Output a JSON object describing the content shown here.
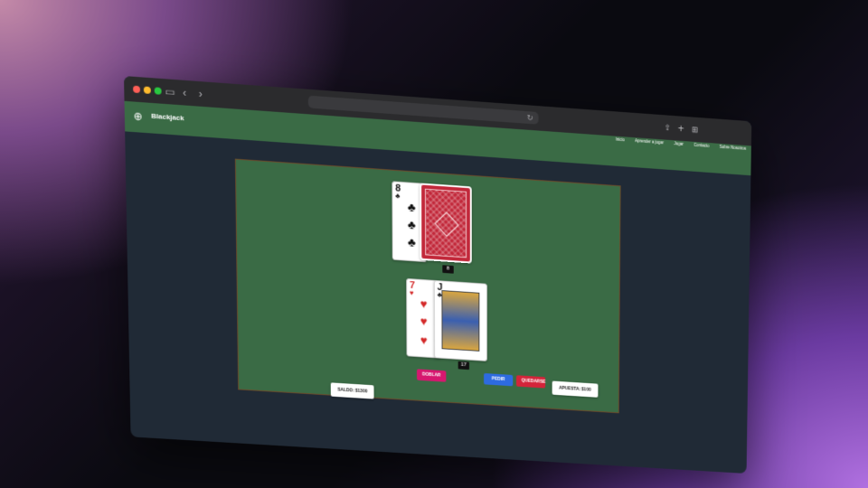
{
  "app": {
    "brand": "Blackjack"
  },
  "nav": {
    "links": [
      "Inicio",
      "Aprender a jugar",
      "Jugar",
      "Contacto",
      "Sobre Nosotros"
    ]
  },
  "dealer": {
    "cards": [
      {
        "rank": "8",
        "suit": "♣",
        "color": "#111111",
        "face_up": true
      },
      {
        "face_up": false
      }
    ],
    "score": "8"
  },
  "player": {
    "cards": [
      {
        "rank": "7",
        "suit": "♥",
        "color": "#d42a2a",
        "face_up": true
      },
      {
        "rank": "J",
        "suit": "♣",
        "color": "#111111",
        "face_up": true
      }
    ],
    "score": "17"
  },
  "actions": {
    "double": "DOBLAR",
    "hit": "PEDIR",
    "stand": "QUEDARSE"
  },
  "balance": {
    "label": "SALDO: $1300"
  },
  "bet": {
    "label": "APUESTA: $100"
  },
  "colors": {
    "table_felt": "#3a6b45",
    "page_bg": "#202a36",
    "double_btn": "#d6176f",
    "hit_btn": "#2d6be0",
    "stand_btn": "#d4243a"
  }
}
